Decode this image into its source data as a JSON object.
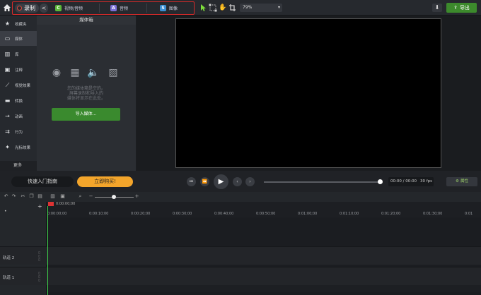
{
  "toolbar": {
    "record_label": "录制",
    "back_label": "<",
    "tabs": [
      {
        "label": "视频/音频",
        "icon": "video-audio-icon",
        "color": "#5cb839",
        "glyph": "C"
      },
      {
        "label": "音频",
        "icon": "audio-icon",
        "color": "#7b6fd6",
        "glyph": "A"
      },
      {
        "label": "图像",
        "icon": "image-icon",
        "color": "#3b8fd3",
        "glyph": "S"
      }
    ],
    "zoom": "79%",
    "export_label": "导出"
  },
  "sidebar": {
    "items": [
      {
        "label": "收藏夹",
        "icon": "star-icon"
      },
      {
        "label": "媒体",
        "icon": "media-icon"
      },
      {
        "label": "库",
        "icon": "library-icon"
      },
      {
        "label": "注释",
        "icon": "annotation-icon"
      },
      {
        "label": "视觉效果",
        "icon": "visual-effects-icon"
      },
      {
        "label": "转换",
        "icon": "transition-icon"
      },
      {
        "label": "动画",
        "icon": "animation-icon"
      },
      {
        "label": "行为",
        "icon": "behavior-icon"
      },
      {
        "label": "光标效果",
        "icon": "cursor-effects-icon"
      }
    ],
    "more_label": "更多",
    "add_label": "+"
  },
  "media_bin": {
    "title": "媒体箱",
    "empty_line1": "您的媒体箱是空的。",
    "empty_line2": "屏幕录制和导入的",
    "empty_line3": "媒体将显示在此处。",
    "import_label": "导入媒体..."
  },
  "playback": {
    "quick_start": "快速入门指南",
    "buy_now": "立即购买!",
    "time": "00:00 / 00:00",
    "fps": "30 fps",
    "properties": "属性"
  },
  "timeline": {
    "playhead_time": "0:00:00;00",
    "ticks": [
      "0:00:00;00",
      "0:00:10;00",
      "0:00:20;00",
      "0:00:30;00",
      "0:00:40;00",
      "0:00:50;00",
      "0:01:00;00",
      "0:01:10;00",
      "0:01:20;00",
      "0:01:30;00",
      "0:01"
    ],
    "tracks": [
      {
        "label": "轨道 2"
      },
      {
        "label": "轨道 1"
      }
    ]
  }
}
